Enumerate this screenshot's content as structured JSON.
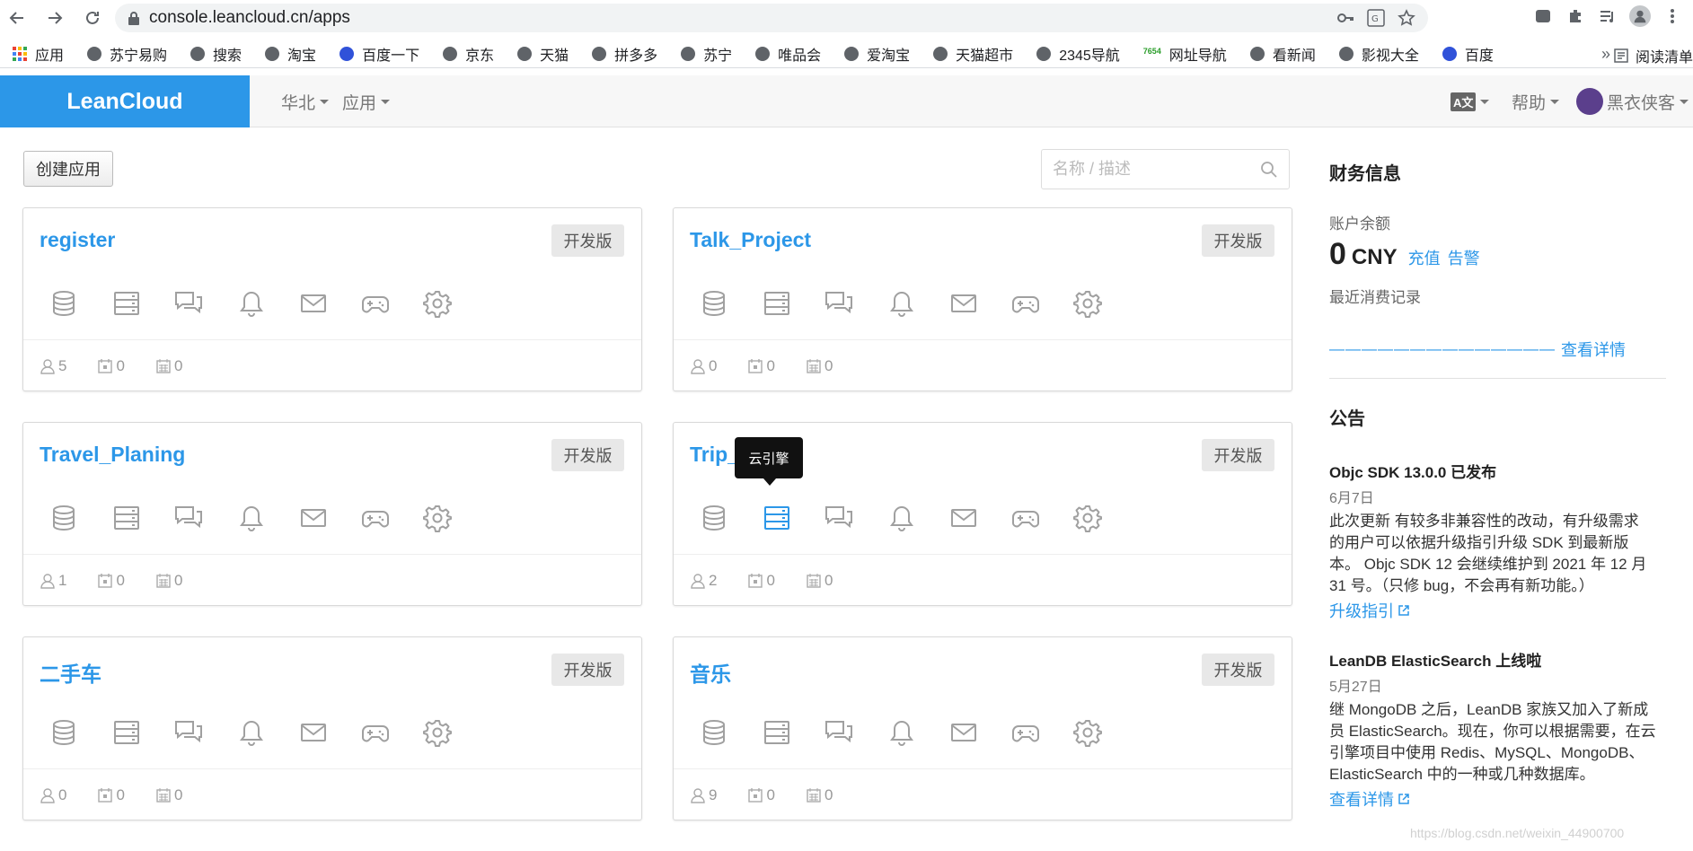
{
  "browser": {
    "url": "console.leancloud.cn/apps",
    "bookmarks": [
      "应用",
      "苏宁易购",
      "搜索",
      "淘宝",
      "百度一下",
      "京东",
      "天猫",
      "拼多多",
      "苏宁",
      "唯品会",
      "爱淘宝",
      "天猫超市",
      "2345导航",
      "网址导航",
      "看新闻",
      "影视大全",
      "百度"
    ],
    "more": "»",
    "reading_list": "阅读清单"
  },
  "header": {
    "brand": "LeanCloud",
    "region": "华北",
    "apps_menu": "应用",
    "lang_icon": "A文",
    "help": "帮助",
    "user": "黑衣侠客"
  },
  "toolbar": {
    "create_label": "创建应用",
    "search_placeholder": "名称 / 描述"
  },
  "apps": [
    {
      "name": "register",
      "badge": "开发版",
      "users": "5",
      "daily": "0",
      "monthly": "0"
    },
    {
      "name": "Talk_Project",
      "badge": "开发版",
      "users": "0",
      "daily": "0",
      "monthly": "0"
    },
    {
      "name": "Travel_Planing",
      "badge": "开发版",
      "users": "1",
      "daily": "0",
      "monthly": "0"
    },
    {
      "name": "Trip_",
      "name_tail": "t",
      "badge": "开发版",
      "users": "2",
      "daily": "0",
      "monthly": "0"
    },
    {
      "name": "二手车",
      "badge": "开发版",
      "users": "0",
      "daily": "0",
      "monthly": "0"
    },
    {
      "name": "音乐",
      "badge": "开发版",
      "users": "9",
      "daily": "0",
      "monthly": "0"
    }
  ],
  "tooltip": "云引擎",
  "finance": {
    "title": "财务信息",
    "balance_label": "账户余额",
    "balance": "0",
    "currency": "CNY",
    "recharge": "充值",
    "alert": "告警",
    "recent_label": "最近消费记录",
    "dashes": "——————————————",
    "details": "查看详情"
  },
  "announcements": {
    "title": "公告",
    "items": [
      {
        "title": "Objc SDK 13.0.0 已发布",
        "date": "6月7日",
        "lines": [
          "此次更新 有较多非兼容性的改动，有升级需求",
          "的用户可以依据升级指引升级 SDK 到最新版",
          "本。 Objc SDK 12 会继续维护到 2021 年 12 月",
          "31 号。（只修 bug，不会再有新功能。）"
        ],
        "link": "升级指引"
      },
      {
        "title": "LeanDB ElasticSearch 上线啦",
        "date": "5月27日",
        "lines": [
          "继 MongoDB 之后，LeanDB 家族又加入了新成",
          "员 ElasticSearch。现在，你可以根据需要，在云",
          "引擎项目中使用 Redis、MySQL、MongoDB、",
          "ElasticSearch 中的一种或几种数据库。"
        ],
        "link": "查看详情"
      }
    ]
  },
  "watermark": "https://blog.csdn.net/weixin_44900700",
  "colors": {
    "brand": "#2c97e8",
    "icon_gray": "#a0a0a0",
    "badge_bg": "#e8e8e8"
  }
}
